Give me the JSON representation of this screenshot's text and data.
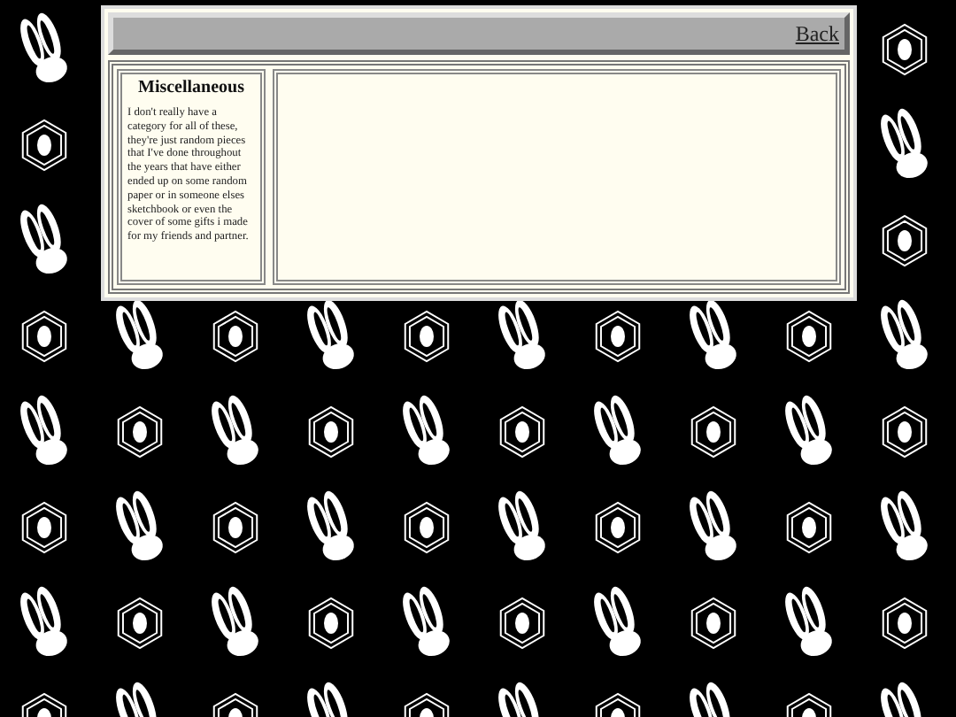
{
  "header": {
    "back_link": "Back"
  },
  "sidebar": {
    "title": "Miscellaneous",
    "description": "I don't really have a category for all of these, they're just random pieces that I've done throughout the years that have either ended up on some random paper or in someone elses sketchbook or even the cover of some gifts i made for my friends and partner."
  }
}
